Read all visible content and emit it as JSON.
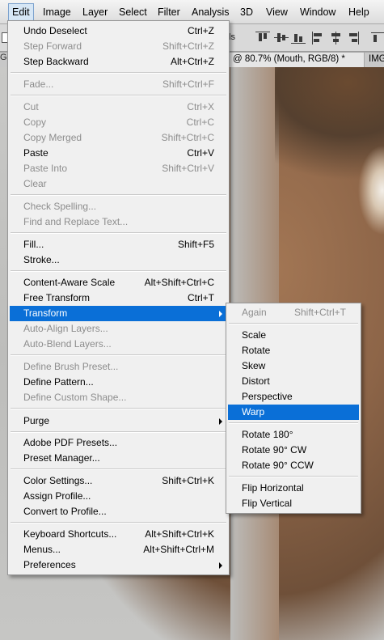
{
  "menubar": {
    "items": [
      "Edit",
      "Image",
      "Layer",
      "Select",
      "Filter",
      "Analysis",
      "3D",
      "View",
      "Window",
      "Help"
    ]
  },
  "options_bar": {
    "partial_text": "ls"
  },
  "tabs": {
    "left_fragment": "G",
    "document": "@ 80.7% (Mouth, RGB/8) *",
    "right_fragment": "IMG"
  },
  "edit_menu": {
    "items": [
      {
        "label": "Undo Deselect",
        "shortcut": "Ctrl+Z",
        "disabled": false
      },
      {
        "label": "Step Forward",
        "shortcut": "Shift+Ctrl+Z",
        "disabled": true
      },
      {
        "label": "Step Backward",
        "shortcut": "Alt+Ctrl+Z",
        "disabled": false
      },
      {
        "label": "Fade...",
        "shortcut": "Shift+Ctrl+F",
        "disabled": true
      },
      {
        "label": "Cut",
        "shortcut": "Ctrl+X",
        "disabled": true
      },
      {
        "label": "Copy",
        "shortcut": "Ctrl+C",
        "disabled": true
      },
      {
        "label": "Copy Merged",
        "shortcut": "Shift+Ctrl+C",
        "disabled": true
      },
      {
        "label": "Paste",
        "shortcut": "Ctrl+V",
        "disabled": false
      },
      {
        "label": "Paste Into",
        "shortcut": "Shift+Ctrl+V",
        "disabled": true
      },
      {
        "label": "Clear",
        "shortcut": "",
        "disabled": true
      },
      {
        "label": "Check Spelling...",
        "shortcut": "",
        "disabled": true
      },
      {
        "label": "Find and Replace Text...",
        "shortcut": "",
        "disabled": true
      },
      {
        "label": "Fill...",
        "shortcut": "Shift+F5",
        "disabled": false
      },
      {
        "label": "Stroke...",
        "shortcut": "",
        "disabled": false
      },
      {
        "label": "Content-Aware Scale",
        "shortcut": "Alt+Shift+Ctrl+C",
        "disabled": false
      },
      {
        "label": "Free Transform",
        "shortcut": "Ctrl+T",
        "disabled": false
      },
      {
        "label": "Transform",
        "shortcut": "",
        "disabled": false,
        "submenu": true,
        "selected": true
      },
      {
        "label": "Auto-Align Layers...",
        "shortcut": "",
        "disabled": true
      },
      {
        "label": "Auto-Blend Layers...",
        "shortcut": "",
        "disabled": true
      },
      {
        "label": "Define Brush Preset...",
        "shortcut": "",
        "disabled": true
      },
      {
        "label": "Define Pattern...",
        "shortcut": "",
        "disabled": false
      },
      {
        "label": "Define Custom Shape...",
        "shortcut": "",
        "disabled": true
      },
      {
        "label": "Purge",
        "shortcut": "",
        "disabled": false,
        "submenu": true
      },
      {
        "label": "Adobe PDF Presets...",
        "shortcut": "",
        "disabled": false
      },
      {
        "label": "Preset Manager...",
        "shortcut": "",
        "disabled": false
      },
      {
        "label": "Color Settings...",
        "shortcut": "Shift+Ctrl+K",
        "disabled": false
      },
      {
        "label": "Assign Profile...",
        "shortcut": "",
        "disabled": false
      },
      {
        "label": "Convert to Profile...",
        "shortcut": "",
        "disabled": false
      },
      {
        "label": "Keyboard Shortcuts...",
        "shortcut": "Alt+Shift+Ctrl+K",
        "disabled": false
      },
      {
        "label": "Menus...",
        "shortcut": "Alt+Shift+Ctrl+M",
        "disabled": false
      },
      {
        "label": "Preferences",
        "shortcut": "",
        "disabled": false,
        "submenu": true
      }
    ]
  },
  "transform_submenu": {
    "items": [
      {
        "label": "Again",
        "shortcut": "Shift+Ctrl+T",
        "disabled": true
      },
      {
        "label": "Scale",
        "shortcut": "",
        "disabled": false
      },
      {
        "label": "Rotate",
        "shortcut": "",
        "disabled": false
      },
      {
        "label": "Skew",
        "shortcut": "",
        "disabled": false
      },
      {
        "label": "Distort",
        "shortcut": "",
        "disabled": false
      },
      {
        "label": "Perspective",
        "shortcut": "",
        "disabled": false
      },
      {
        "label": "Warp",
        "shortcut": "",
        "disabled": false,
        "selected": true
      },
      {
        "label": "Rotate 180°",
        "shortcut": "",
        "disabled": false
      },
      {
        "label": "Rotate 90° CW",
        "shortcut": "",
        "disabled": false
      },
      {
        "label": "Rotate 90° CCW",
        "shortcut": "",
        "disabled": false
      },
      {
        "label": "Flip Horizontal",
        "shortcut": "",
        "disabled": false
      },
      {
        "label": "Flip Vertical",
        "shortcut": "",
        "disabled": false
      }
    ]
  },
  "colors": {
    "highlight": "#0a6fd7",
    "disabled_text": "#8d8d8d",
    "menu_bg": "#f0f0f0"
  }
}
